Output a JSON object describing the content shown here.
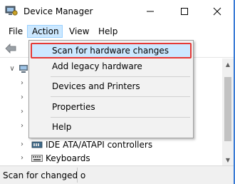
{
  "window": {
    "title": "Device Manager",
    "icons": {
      "app": "device-manager-icon",
      "minimize": "minimize-icon",
      "maximize": "maximize-icon",
      "close": "close-icon"
    }
  },
  "menubar": {
    "items": [
      {
        "label": "File"
      },
      {
        "label": "Action"
      },
      {
        "label": "View"
      },
      {
        "label": "Help"
      }
    ]
  },
  "toolbar": {
    "icons": [
      "back-arrow-icon"
    ]
  },
  "action_menu": {
    "items": [
      {
        "label": "Scan for hardware changes",
        "highlighted": true
      },
      {
        "label": "Add legacy hardware"
      },
      {
        "label": "Devices and Printers"
      },
      {
        "label": "Properties"
      },
      {
        "label": "Help"
      }
    ]
  },
  "tree": {
    "visible_items": [
      {
        "label": "IDE ATA/ATAPI controllers",
        "icon": "ide-controller-icon"
      },
      {
        "label": "Keyboards",
        "icon": "keyboard-icon"
      }
    ]
  },
  "statusbar": {
    "text": "Scan for changed o"
  },
  "colors": {
    "highlight": "#cce8ff",
    "callout_border": "#e53935",
    "menu_bg": "#f2f2f2"
  }
}
